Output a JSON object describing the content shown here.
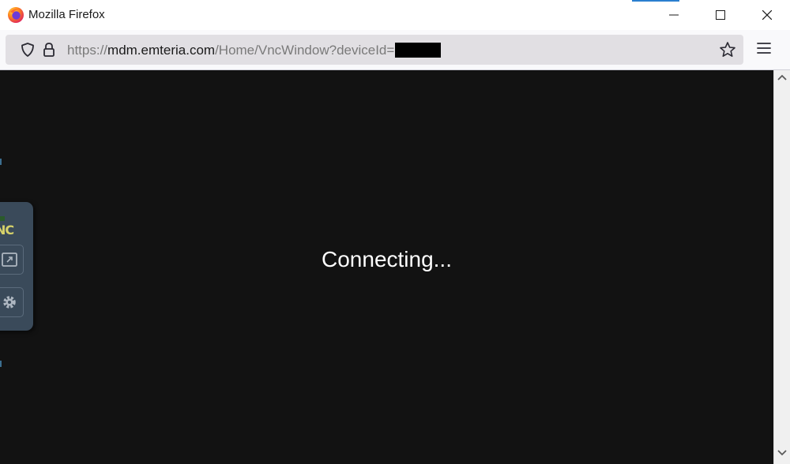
{
  "window": {
    "title": "Mozilla Firefox",
    "icon": "firefox-logo-icon",
    "controls": [
      "minimize-icon",
      "maximize-icon",
      "close-icon"
    ]
  },
  "urlbar": {
    "url_scheme": "https://",
    "url_host": "mdm.emteria.com",
    "url_path": "/Home/VncWindow?deviceId=",
    "redacted": true
  },
  "page": {
    "status_text": "Connecting...",
    "background": "#121212"
  },
  "vnc_panel": {
    "logo_text": "NC",
    "buttons": [
      "fullscreen-icon",
      "gear-icon"
    ]
  },
  "colors": {
    "content_bg": "#121212",
    "panel_bg": "#3a4a5a",
    "logo": "#d7d26a"
  }
}
